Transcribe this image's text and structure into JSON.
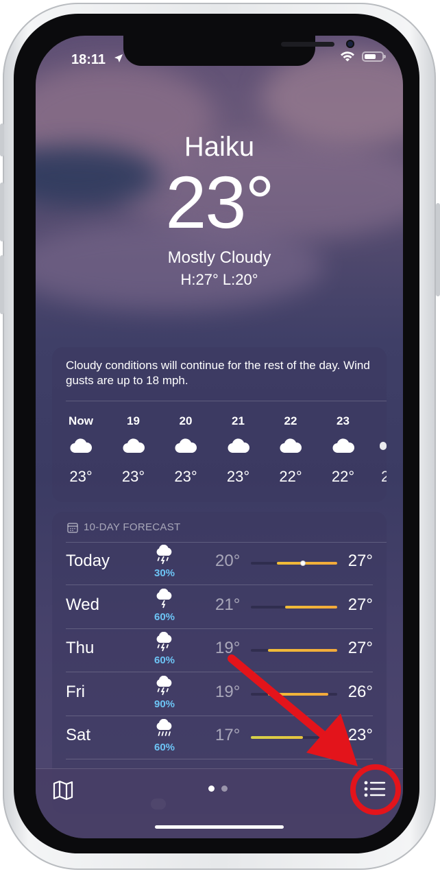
{
  "status": {
    "time": "18:11"
  },
  "location": {
    "city": "Haiku",
    "temperature": "23°",
    "condition": "Mostly Cloudy",
    "hilo": "H:27°  L:20°"
  },
  "hourly": {
    "summary": "Cloudy conditions will continue for the rest of the day. Wind gusts are up to 18 mph.",
    "hours": [
      {
        "label": "Now",
        "icon": "cloud-icon",
        "temp": "23°"
      },
      {
        "label": "19",
        "icon": "cloud-icon",
        "temp": "23°"
      },
      {
        "label": "20",
        "icon": "cloud-icon",
        "temp": "23°"
      },
      {
        "label": "21",
        "icon": "cloud-icon",
        "temp": "23°"
      },
      {
        "label": "22",
        "icon": "cloud-icon",
        "temp": "22°"
      },
      {
        "label": "23",
        "icon": "cloud-icon",
        "temp": "22°"
      }
    ]
  },
  "forecast": {
    "header": "10-DAY FORECAST",
    "days": [
      {
        "day": "Today",
        "icon": "thunderstorm-rain-icon",
        "pop": "30%",
        "low": "20°",
        "high": "27°",
        "low_value": 20,
        "high_value": 27,
        "current_value": 23
      },
      {
        "day": "Wed",
        "icon": "thunderstorm-icon",
        "pop": "60%",
        "low": "21°",
        "high": "27°",
        "low_value": 21,
        "high_value": 27
      },
      {
        "day": "Thu",
        "icon": "thunderstorm-rain-icon",
        "pop": "60%",
        "low": "19°",
        "high": "27°",
        "low_value": 19,
        "high_value": 27
      },
      {
        "day": "Fri",
        "icon": "thunderstorm-rain-icon",
        "pop": "90%",
        "low": "19°",
        "high": "26°",
        "low_value": 19,
        "high_value": 26
      },
      {
        "day": "Sat",
        "icon": "rain-icon",
        "pop": "60%",
        "low": "17°",
        "high": "23°",
        "low_value": 17,
        "high_value": 23
      }
    ],
    "range_min": 17,
    "range_max": 27
  },
  "page_indicator": {
    "pages": 2,
    "current_page": 1
  },
  "colors": {
    "accent_annotation": "#e3141b",
    "precipitation": "#6dc4f5",
    "bar_warm": "#f2a93b",
    "bar_cool": "#d6d24a"
  }
}
